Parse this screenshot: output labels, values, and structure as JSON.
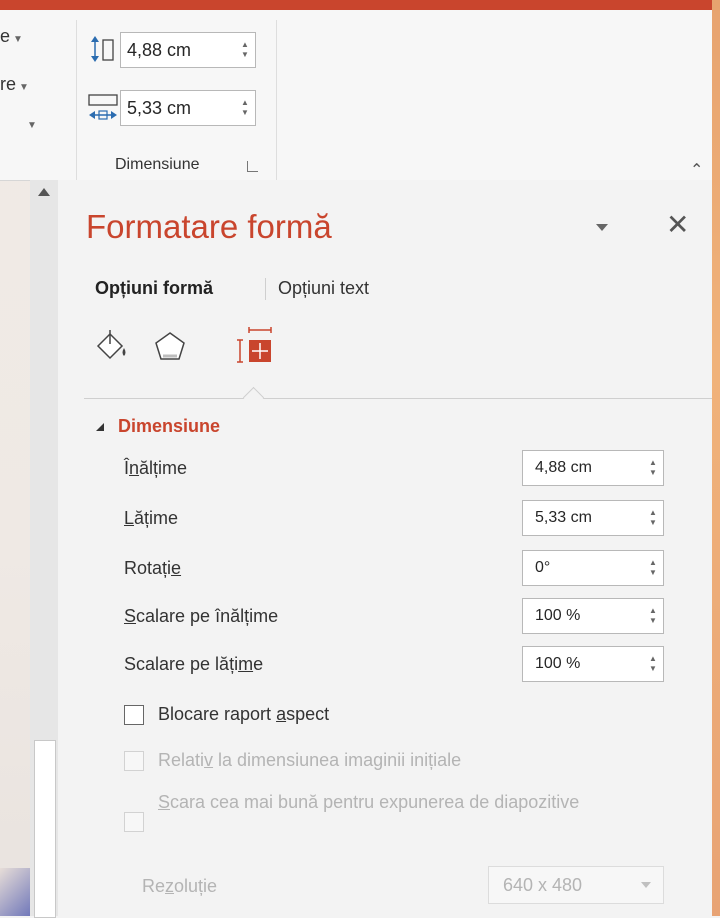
{
  "ribbon": {
    "left_items": [
      "e",
      "re",
      ""
    ],
    "height_value": "4,88 cm",
    "width_value": "5,33 cm",
    "group_label": "Dimensiune"
  },
  "pane": {
    "title": "Formatare formă",
    "tabs": [
      {
        "label": "Opțiuni formă",
        "active": true
      },
      {
        "label": "Opțiuni text",
        "active": false
      }
    ],
    "icons": [
      "fill-line-icon",
      "effects-pentagon-icon",
      "size-properties-icon"
    ],
    "section": {
      "title": "Dimensiune",
      "properties": [
        {
          "label_pre": "Î",
          "label_u": "n",
          "label_post": "ălțime",
          "value": "4,88 cm"
        },
        {
          "label_pre": "",
          "label_u": "L",
          "label_post": "ățime",
          "value": "5,33 cm"
        },
        {
          "label_pre": "Rotați",
          "label_u": "e",
          "label_post": "",
          "value": "0°"
        },
        {
          "label_pre": "",
          "label_u": "S",
          "label_post": "calare pe înălțime",
          "value": "100 %"
        },
        {
          "label_pre": "Scalare pe lăți",
          "label_u": "m",
          "label_post": "e",
          "value": "100 %"
        }
      ],
      "checkboxes": [
        {
          "label_pre": "Blocare raport ",
          "label_u": "a",
          "label_post": "spect",
          "enabled": true
        },
        {
          "label_pre": "Relati",
          "label_u": "v",
          "label_post": " la dimensiunea imaginii inițiale",
          "enabled": false
        },
        {
          "label_pre": "",
          "label_u": "S",
          "label_post": "cara cea mai bună pentru expunerea de diapozitive",
          "enabled": false
        }
      ],
      "resolution": {
        "label_pre": "Re",
        "label_u": "z",
        "label_post": "oluție",
        "value": "640 x 480"
      }
    }
  },
  "colors": {
    "accent": "#c9452d",
    "text": "#333333",
    "disabled": "#b4b4b4"
  }
}
